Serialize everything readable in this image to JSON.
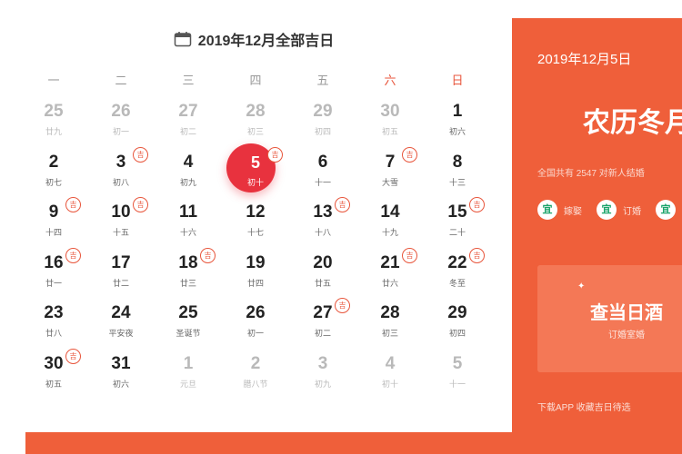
{
  "calendar": {
    "title": "2019年12月全部吉日",
    "weekdays": [
      {
        "label": "一",
        "weekend": false
      },
      {
        "label": "二",
        "weekend": false
      },
      {
        "label": "三",
        "weekend": false
      },
      {
        "label": "四",
        "weekend": false
      },
      {
        "label": "五",
        "weekend": false
      },
      {
        "label": "六",
        "weekend": true
      },
      {
        "label": "日",
        "weekend": true
      }
    ],
    "badge_text": "吉",
    "colors": {
      "accent": "#e8563c",
      "today": "#e8323e",
      "panel": "#ef5f3a"
    },
    "days": [
      {
        "num": "25",
        "lunar": "廿九",
        "current": false,
        "good": false,
        "today": false
      },
      {
        "num": "26",
        "lunar": "初一",
        "current": false,
        "good": false,
        "today": false
      },
      {
        "num": "27",
        "lunar": "初二",
        "current": false,
        "good": false,
        "today": false
      },
      {
        "num": "28",
        "lunar": "初三",
        "current": false,
        "good": false,
        "today": false
      },
      {
        "num": "29",
        "lunar": "初四",
        "current": false,
        "good": false,
        "today": false
      },
      {
        "num": "30",
        "lunar": "初五",
        "current": false,
        "good": false,
        "today": false
      },
      {
        "num": "1",
        "lunar": "初六",
        "current": true,
        "good": false,
        "today": false
      },
      {
        "num": "2",
        "lunar": "初七",
        "current": true,
        "good": false,
        "today": false
      },
      {
        "num": "3",
        "lunar": "初八",
        "current": true,
        "good": true,
        "today": false
      },
      {
        "num": "4",
        "lunar": "初九",
        "current": true,
        "good": false,
        "today": false
      },
      {
        "num": "5",
        "lunar": "初十",
        "current": true,
        "good": true,
        "today": true
      },
      {
        "num": "6",
        "lunar": "十一",
        "current": true,
        "good": false,
        "today": false
      },
      {
        "num": "7",
        "lunar": "大雪",
        "current": true,
        "good": true,
        "today": false
      },
      {
        "num": "8",
        "lunar": "十三",
        "current": true,
        "good": false,
        "today": false
      },
      {
        "num": "9",
        "lunar": "十四",
        "current": true,
        "good": true,
        "today": false
      },
      {
        "num": "10",
        "lunar": "十五",
        "current": true,
        "good": true,
        "today": false
      },
      {
        "num": "11",
        "lunar": "十六",
        "current": true,
        "good": false,
        "today": false
      },
      {
        "num": "12",
        "lunar": "十七",
        "current": true,
        "good": false,
        "today": false
      },
      {
        "num": "13",
        "lunar": "十八",
        "current": true,
        "good": true,
        "today": false
      },
      {
        "num": "14",
        "lunar": "十九",
        "current": true,
        "good": false,
        "today": false
      },
      {
        "num": "15",
        "lunar": "二十",
        "current": true,
        "good": true,
        "today": false
      },
      {
        "num": "16",
        "lunar": "廿一",
        "current": true,
        "good": true,
        "today": false
      },
      {
        "num": "17",
        "lunar": "廿二",
        "current": true,
        "good": false,
        "today": false
      },
      {
        "num": "18",
        "lunar": "廿三",
        "current": true,
        "good": true,
        "today": false
      },
      {
        "num": "19",
        "lunar": "廿四",
        "current": true,
        "good": false,
        "today": false
      },
      {
        "num": "20",
        "lunar": "廿五",
        "current": true,
        "good": false,
        "today": false
      },
      {
        "num": "21",
        "lunar": "廿六",
        "current": true,
        "good": true,
        "today": false
      },
      {
        "num": "22",
        "lunar": "冬至",
        "current": true,
        "good": true,
        "today": false
      },
      {
        "num": "23",
        "lunar": "廿八",
        "current": true,
        "good": false,
        "today": false
      },
      {
        "num": "24",
        "lunar": "平安夜",
        "current": true,
        "good": false,
        "today": false
      },
      {
        "num": "25",
        "lunar": "圣诞节",
        "current": true,
        "good": false,
        "today": false
      },
      {
        "num": "26",
        "lunar": "初一",
        "current": true,
        "good": false,
        "today": false
      },
      {
        "num": "27",
        "lunar": "初二",
        "current": true,
        "good": true,
        "today": false
      },
      {
        "num": "28",
        "lunar": "初三",
        "current": true,
        "good": false,
        "today": false
      },
      {
        "num": "29",
        "lunar": "初四",
        "current": true,
        "good": false,
        "today": false
      },
      {
        "num": "30",
        "lunar": "初五",
        "current": true,
        "good": true,
        "today": false
      },
      {
        "num": "31",
        "lunar": "初六",
        "current": true,
        "good": false,
        "today": false
      },
      {
        "num": "1",
        "lunar": "元旦",
        "current": false,
        "good": false,
        "today": false
      },
      {
        "num": "2",
        "lunar": "腊八节",
        "current": false,
        "good": false,
        "today": false
      },
      {
        "num": "3",
        "lunar": "初九",
        "current": false,
        "good": false,
        "today": false
      },
      {
        "num": "4",
        "lunar": "初十",
        "current": false,
        "good": false,
        "today": false
      },
      {
        "num": "5",
        "lunar": "十一",
        "current": false,
        "good": false,
        "today": false
      }
    ]
  },
  "panel": {
    "date": "2019年12月5日",
    "lunar_date": "农历冬月",
    "count_text": "全国共有 2547 对新人结婚",
    "tags": [
      {
        "icon": "宜",
        "label": "嫁娶"
      },
      {
        "icon": "宜",
        "label": "订婚"
      },
      {
        "icon": "宜",
        "label": ""
      }
    ],
    "cta_title": "查当日酒",
    "cta_sub": "订婚室婚",
    "footer": "下载APP 收藏吉日待选"
  }
}
